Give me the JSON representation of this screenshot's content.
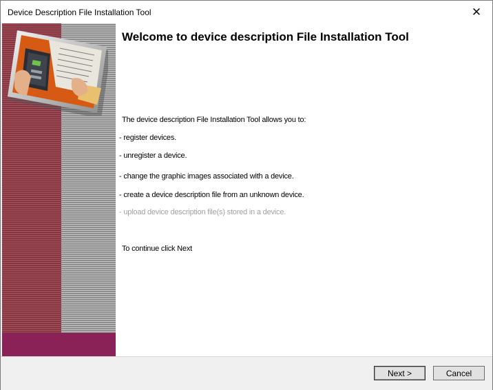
{
  "window": {
    "title": "Device Description File Installation Tool",
    "close_glyph": "✕"
  },
  "sidebar": {
    "image_icon": "device-photo-icon"
  },
  "content": {
    "heading": "Welcome to device description File Installation Tool",
    "intro": "The device description File Installation Tool allows you to:",
    "items": [
      {
        "text": "- register devices.",
        "enabled": true
      },
      {
        "text": "- unregister a device.",
        "enabled": true
      },
      {
        "text": "- change the graphic images associated with a device.",
        "enabled": true
      },
      {
        "text": "- create a device description file from an unknown device.",
        "enabled": true
      },
      {
        "text": "- upload device description file(s) stored in a device.",
        "enabled": false
      }
    ],
    "continue_text": "To continue click Next"
  },
  "buttons": {
    "next": "Next >",
    "cancel": "Cancel"
  },
  "colors": {
    "sidebar_bottom": "#8a2257",
    "sidebar_red": "#7d2b36",
    "disabled_text": "#a0a0a0"
  }
}
